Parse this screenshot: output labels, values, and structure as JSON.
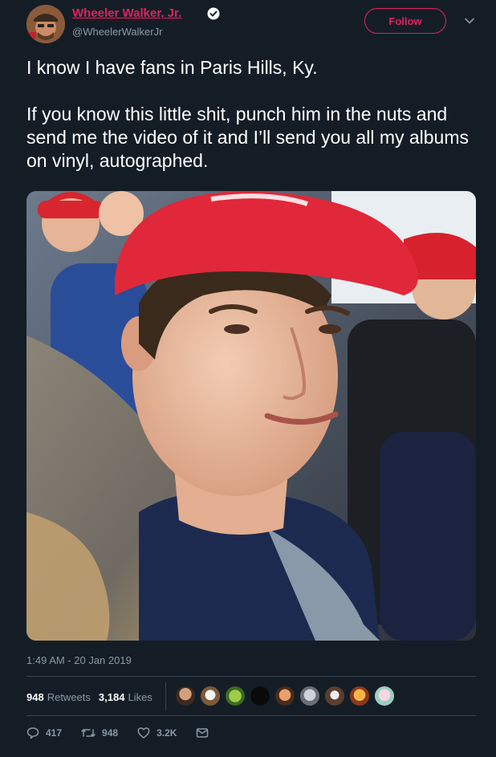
{
  "author": {
    "display_name": "Wheeler Walker, Jr.",
    "handle": "@WheelerWalkerJr",
    "verified": true,
    "avatar_icon": "user-avatar"
  },
  "header": {
    "follow_label": "Follow",
    "menu_icon": "chevron-down-icon"
  },
  "tweet": {
    "paragraphs": [
      "I know I have fans in Paris Hills, Ky.",
      "If you know this little shit, punch him in the nuts and send me the video of it and I’ll send you all my albums on vinyl, autographed."
    ],
    "timestamp": "1:49 AM - 20 Jan 2019"
  },
  "stats": {
    "retweets_count": "948",
    "retweets_label": "Retweets",
    "likes_count": "3,184",
    "likes_label": "Likes"
  },
  "actions": {
    "reply_count": "417",
    "retweet_count": "948",
    "like_count": "3.2K"
  },
  "colors": {
    "background": "#141d26",
    "accent": "#e0245e",
    "muted": "#8899a6",
    "verified": "#ffffff"
  }
}
